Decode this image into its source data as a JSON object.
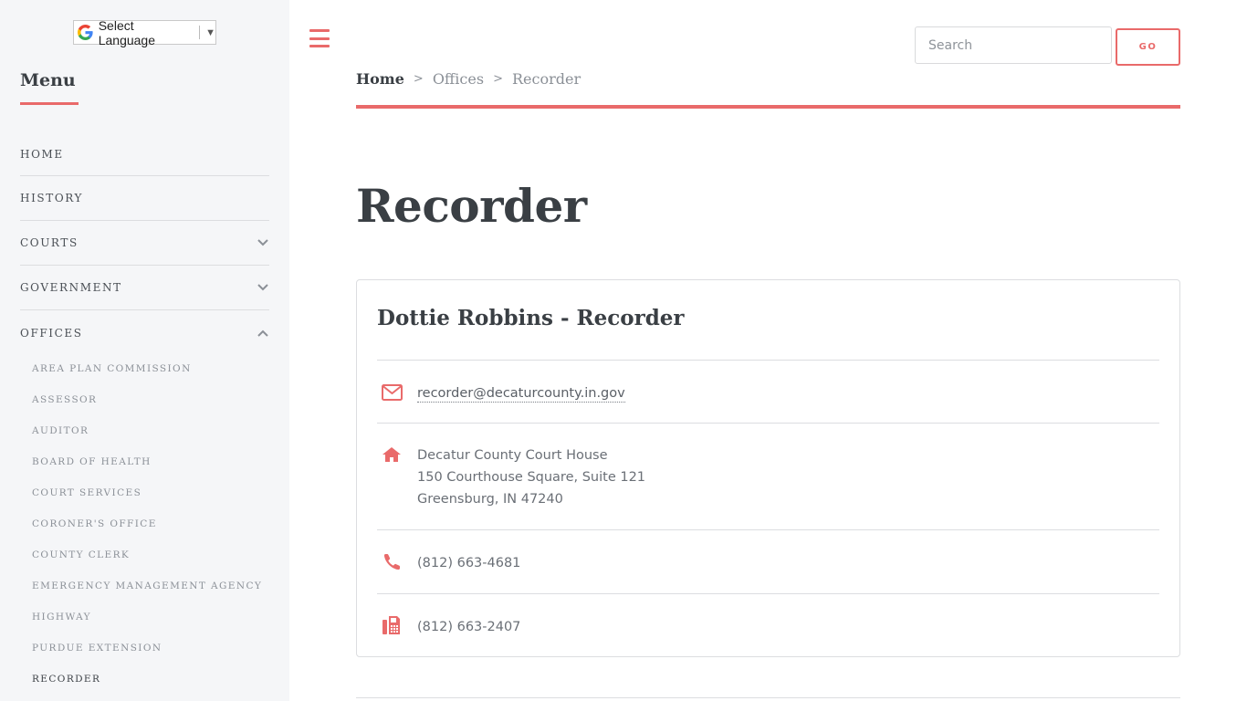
{
  "sidebar": {
    "language_select": "Select Language",
    "menu_heading": "Menu",
    "nav": [
      {
        "label": "HOME"
      },
      {
        "label": "HISTORY"
      },
      {
        "label": "COURTS"
      },
      {
        "label": "GOVERNMENT"
      },
      {
        "label": "OFFICES"
      }
    ],
    "offices_sub": [
      "AREA PLAN COMMISSION",
      "ASSESSOR",
      "AUDITOR",
      "BOARD OF HEALTH",
      "COURT SERVICES",
      "CORONER'S OFFICE",
      "COUNTY CLERK",
      "EMERGENCY MANAGEMENT AGENCY",
      "HIGHWAY",
      "PURDUE EXTENSION",
      "RECORDER"
    ]
  },
  "header": {
    "search_placeholder": "Search",
    "go_label": "GO"
  },
  "breadcrumb": {
    "home": "Home",
    "offices": "Offices",
    "current": "Recorder",
    "separator": ">"
  },
  "page": {
    "title": "Recorder"
  },
  "card": {
    "title": "Dottie Robbins - Recorder",
    "email": "recorder@decaturcounty.in.gov",
    "address": {
      "line1": "Decatur County Court House",
      "line2": "150 Courthouse Square, Suite 121",
      "line3": "Greensburg, IN 47240"
    },
    "phone": "(812) 663-4681",
    "fax": "(812) 663-2407"
  },
  "colors": {
    "accent": "#e96a6a",
    "sidebar_bg": "#f5f6f8",
    "text_dark": "#3a3f44",
    "text_muted": "#8b9097"
  }
}
